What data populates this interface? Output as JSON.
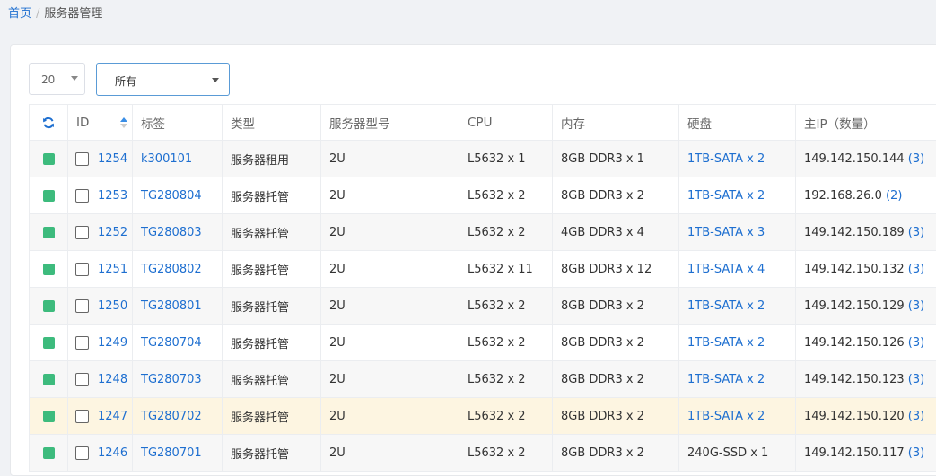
{
  "breadcrumb": {
    "home": "首页",
    "separator": "/",
    "current": "服务器管理"
  },
  "controls": {
    "page_size": "20",
    "filter": "所有"
  },
  "colors": {
    "status_online": "#3dbb7d",
    "link": "#1e6fd0",
    "highlight_row": "#fdf5e1"
  },
  "table": {
    "headers": {
      "refresh": "refresh-icon",
      "id": "ID",
      "label": "标签",
      "type": "类型",
      "model": "服务器型号",
      "cpu": "CPU",
      "memory": "内存",
      "disk": "硬盘",
      "ip": "主IP（数量）"
    },
    "rows": [
      {
        "id": "1254",
        "label": "k300101",
        "type": "服务器租用",
        "model": "2U",
        "cpu": "L5632 x 1",
        "memory": "8GB DDR3 x 1",
        "disk": "1TB-SATA x 2",
        "ip": "149.142.150.144",
        "ip_count": "(3)"
      },
      {
        "id": "1253",
        "label": "TG280804",
        "type": "服务器托管",
        "model": "2U",
        "cpu": "L5632 x 2",
        "memory": "8GB DDR3 x 2",
        "disk": "1TB-SATA x 2",
        "ip": "192.168.26.0",
        "ip_count": "(2)"
      },
      {
        "id": "1252",
        "label": "TG280803",
        "type": "服务器托管",
        "model": "2U",
        "cpu": "L5632 x 2",
        "memory": "4GB DDR3 x 4",
        "disk": "1TB-SATA x 3",
        "ip": "149.142.150.189",
        "ip_count": "(3)"
      },
      {
        "id": "1251",
        "label": "TG280802",
        "type": "服务器托管",
        "model": "2U",
        "cpu": "L5632 x 11",
        "memory": "8GB DDR3 x 12",
        "disk": "1TB-SATA x 4",
        "ip": "149.142.150.132",
        "ip_count": "(3)"
      },
      {
        "id": "1250",
        "label": "TG280801",
        "type": "服务器托管",
        "model": "2U",
        "cpu": "L5632 x 2",
        "memory": "8GB DDR3 x 2",
        "disk": "1TB-SATA x 2",
        "ip": "149.142.150.129",
        "ip_count": "(3)"
      },
      {
        "id": "1249",
        "label": "TG280704",
        "type": "服务器托管",
        "model": "2U",
        "cpu": "L5632 x 2",
        "memory": "8GB DDR3 x 2",
        "disk": "1TB-SATA x 2",
        "ip": "149.142.150.126",
        "ip_count": "(3)"
      },
      {
        "id": "1248",
        "label": "TG280703",
        "type": "服务器托管",
        "model": "2U",
        "cpu": "L5632 x 2",
        "memory": "8GB DDR3 x 2",
        "disk": "1TB-SATA x 2",
        "ip": "149.142.150.123",
        "ip_count": "(3)"
      },
      {
        "id": "1247",
        "label": "TG280702",
        "type": "服务器托管",
        "model": "2U",
        "cpu": "L5632 x 2",
        "memory": "8GB DDR3 x 2",
        "disk": "1TB-SATA x 2",
        "ip": "149.142.150.120",
        "ip_count": "(3)"
      },
      {
        "id": "1246",
        "label": "TG280701",
        "type": "服务器托管",
        "model": "2U",
        "cpu": "L5632 x 2",
        "memory": "8GB DDR3 x 2",
        "disk": "240G-SSD x 1",
        "ip": "149.142.150.117",
        "ip_count": "(3)"
      }
    ]
  }
}
